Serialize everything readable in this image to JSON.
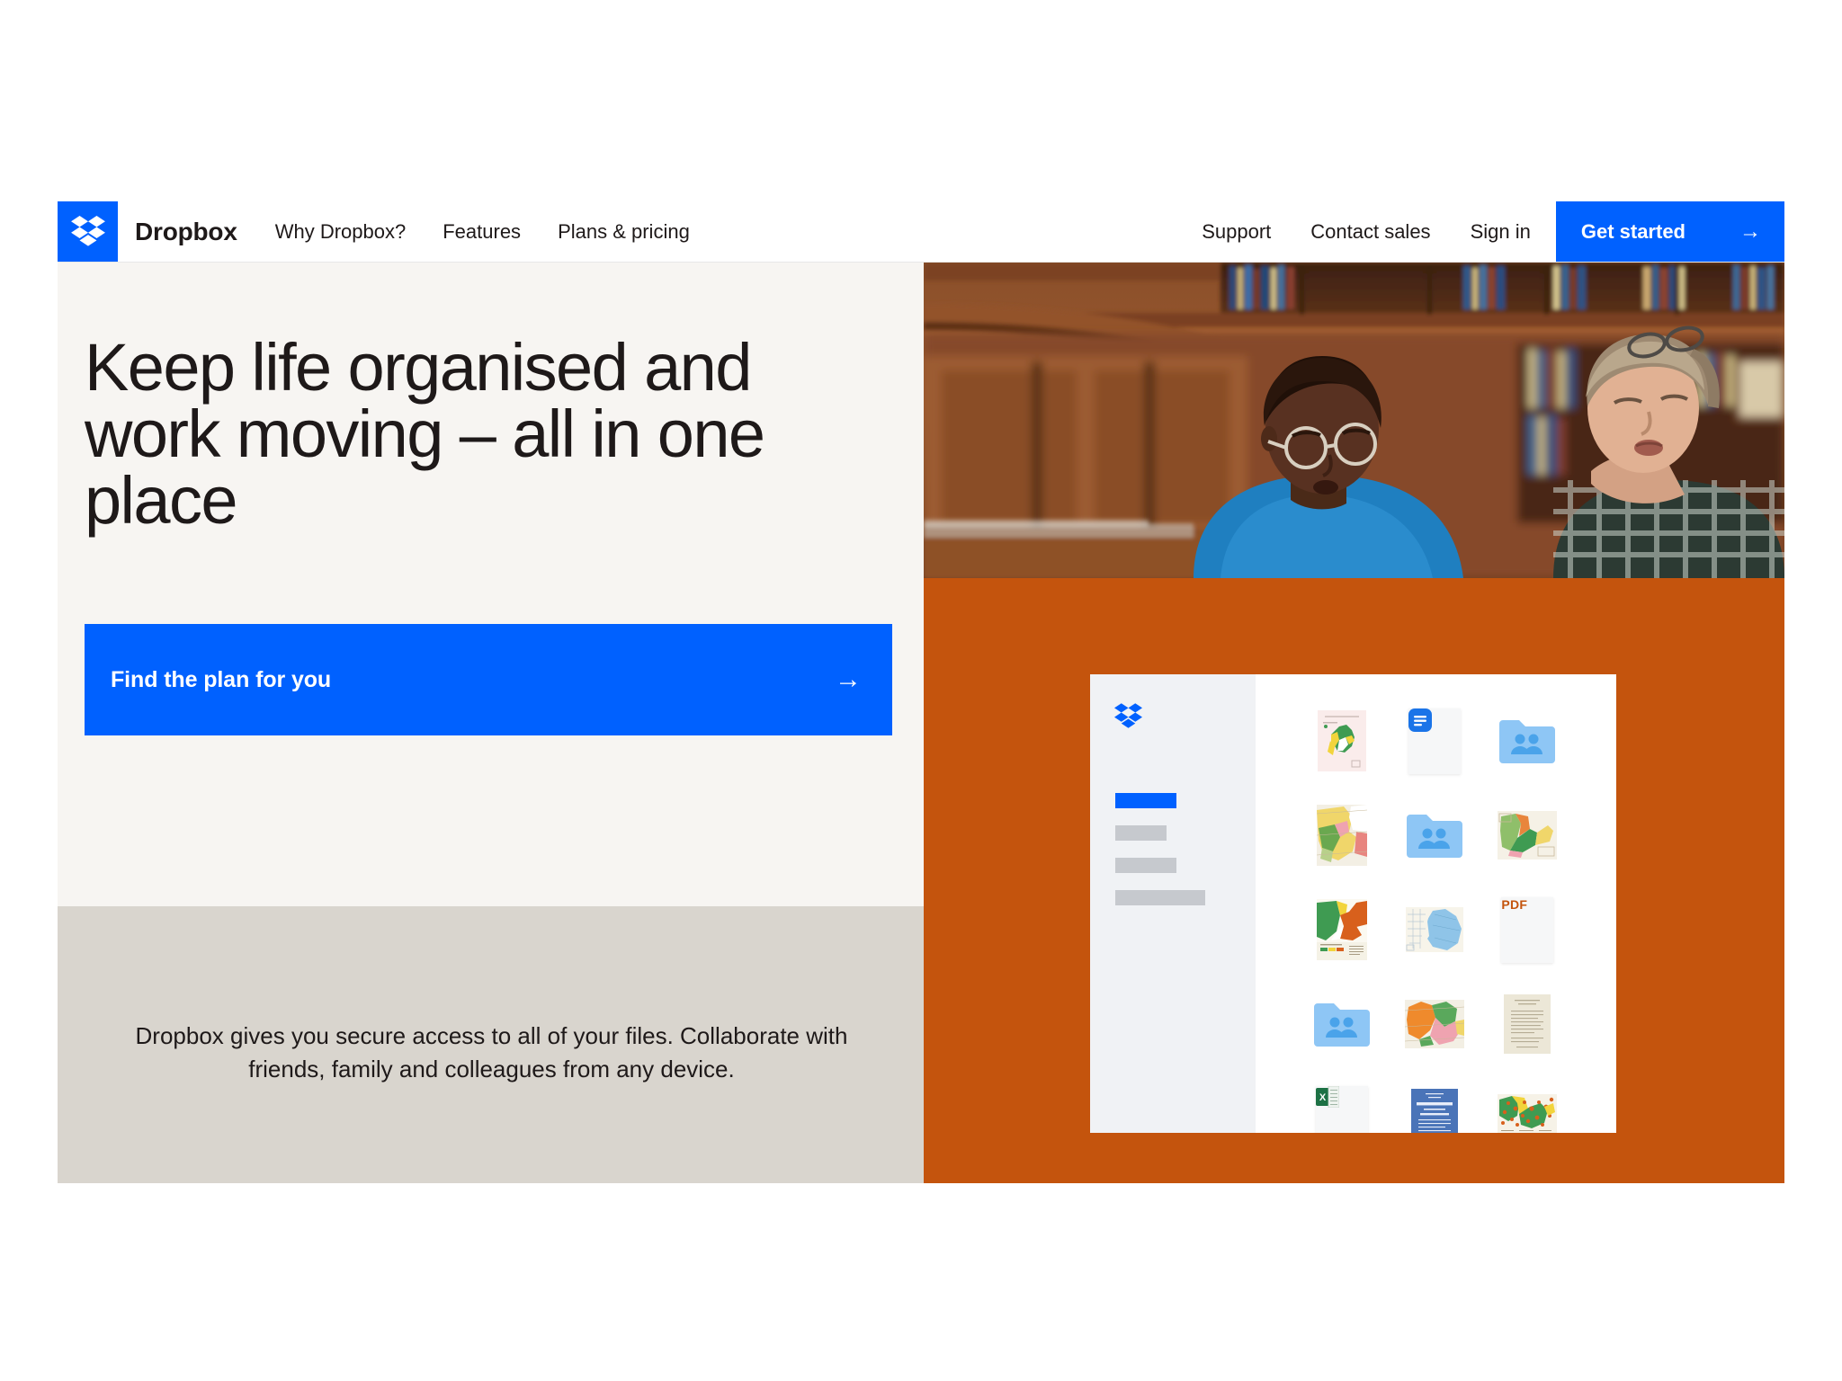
{
  "brand": {
    "name": "Dropbox",
    "logo_icon": "dropbox-logo-icon",
    "accent_blue": "#0061FF",
    "accent_orange": "#C4540D",
    "cream": "#F7F5F2",
    "warm_gray": "#D9D5CE"
  },
  "navbar": {
    "links": [
      {
        "label": "Why Dropbox?"
      },
      {
        "label": "Features"
      },
      {
        "label": "Plans & pricing"
      }
    ],
    "right_links": [
      {
        "label": "Support"
      },
      {
        "label": "Contact sales"
      },
      {
        "label": "Sign in"
      }
    ],
    "cta": {
      "label": "Get started",
      "arrow": "→",
      "icon": "arrow-right-icon"
    }
  },
  "hero": {
    "headline": "Keep life organised and work moving – all in one place",
    "cta": {
      "label": "Find the plan for you",
      "arrow": "→",
      "icon": "arrow-right-icon"
    },
    "description": "Dropbox gives you secure access to all of your files. Collaborate with friends, family and colleagues from any device.",
    "photo": {
      "alt": "Two people collaborating over a table in a wood-panelled library",
      "icon": "library-collaboration-photo"
    }
  },
  "app_mockup": {
    "logo_icon": "dropbox-logo-icon",
    "sidebar_items": [
      {
        "state": "active",
        "width": "w-active"
      },
      {
        "state": "idle",
        "width": "w1"
      },
      {
        "state": "idle",
        "width": "w2"
      },
      {
        "state": "idle",
        "width": "w3"
      }
    ],
    "files": [
      {
        "type": "map",
        "name": "map-thumbnail",
        "palette": [
          "#f7e8e8",
          "#3f9b52",
          "#f2d43c",
          "#ffffff"
        ]
      },
      {
        "type": "paper-doc",
        "name": "dropbox-paper-doc-icon",
        "label": ""
      },
      {
        "type": "shared-folder",
        "name": "shared-folder-icon",
        "label": ""
      },
      {
        "type": "map",
        "name": "map-thumbnail",
        "palette": [
          "#f0d66a",
          "#e8857f",
          "#6aa84f",
          "#f3efe4"
        ]
      },
      {
        "type": "shared-folder",
        "name": "shared-folder-icon",
        "label": ""
      },
      {
        "type": "map",
        "name": "map-thumbnail",
        "palette": [
          "#f3efe4",
          "#58a15c",
          "#e8853c",
          "#f0d66a"
        ]
      },
      {
        "type": "map",
        "name": "map-thumbnail",
        "palette": [
          "#3f9b52",
          "#d8601c",
          "#f2d43c",
          "#ffffff"
        ]
      },
      {
        "type": "map",
        "name": "map-thumbnail",
        "palette": [
          "#f4f1e8",
          "#7fb7e0",
          "#cfd9e0",
          "#ffffff"
        ]
      },
      {
        "type": "pdf",
        "name": "pdf-file-icon",
        "label": "PDF"
      },
      {
        "type": "shared-folder",
        "name": "shared-folder-icon",
        "label": ""
      },
      {
        "type": "map",
        "name": "map-thumbnail",
        "palette": [
          "#ef8a2c",
          "#5aa85c",
          "#efa3b0",
          "#f3efe4"
        ]
      },
      {
        "type": "text-doc",
        "name": "text-document-thumbnail",
        "label": ""
      },
      {
        "type": "spreadsheet",
        "name": "excel-file-icon",
        "label": "X"
      },
      {
        "type": "blue-doc",
        "name": "blue-document-thumbnail",
        "label": ""
      },
      {
        "type": "map",
        "name": "map-thumbnail",
        "palette": [
          "#f3efe4",
          "#d8601c",
          "#3f9b52",
          "#f2d43c"
        ]
      }
    ]
  }
}
